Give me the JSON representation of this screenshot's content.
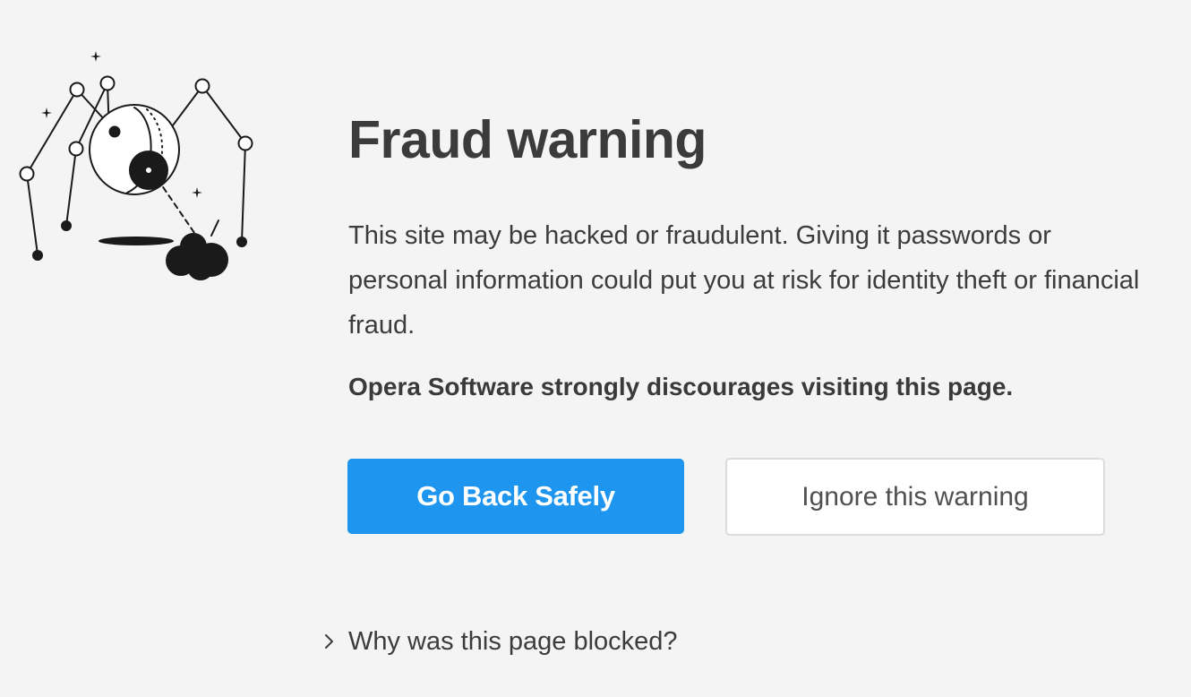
{
  "illustration": {
    "name": "spider-monster-illustration"
  },
  "main": {
    "title": "Fraud warning",
    "description": "This site may be hacked or fraudulent. Giving it passwords or personal information could put you at risk for identity theft or financial fraud.",
    "strong_note": "Opera Software strongly discourages visiting this page."
  },
  "buttons": {
    "primary_label": "Go Back Safely",
    "secondary_label": "Ignore this warning"
  },
  "details": {
    "toggle_label": "Why was this page blocked?",
    "icon": "chevron-right-icon"
  },
  "colors": {
    "background": "#f4f4f4",
    "primary_button": "#1e96f0",
    "text": "#3c3c3c"
  }
}
